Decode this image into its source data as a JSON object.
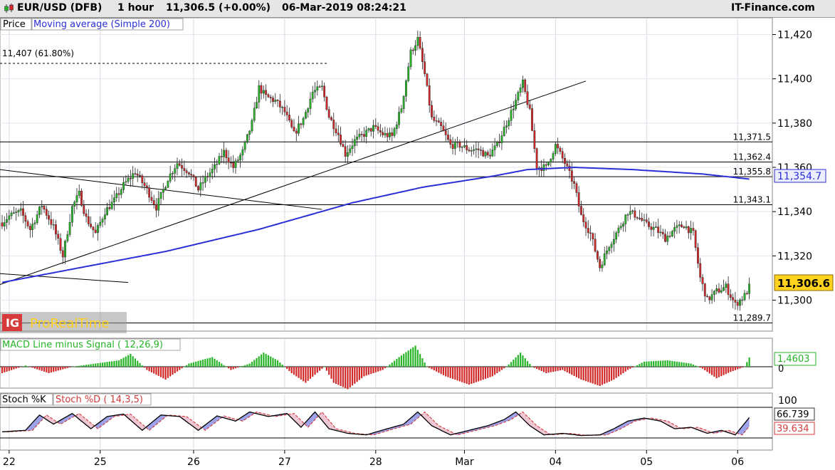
{
  "header": {
    "instrument": "EUR/USD (DFB)",
    "timeframe": "1 hour",
    "last_price": "11,306.5 (+0.00%)",
    "datetime": "06-Mar-2019 08:24:21",
    "brand": "IT-Finance.com"
  },
  "price_panel": {
    "legend_price": "Price",
    "legend_ma": "Moving average (Simple 200)",
    "fib_label": "11,407 (61.80%)",
    "watermark": "ProRealTime",
    "watermark_logo_letters": "IG",
    "current_price_tag": "11,306.6",
    "ma_value_tag": "11,354.7"
  },
  "macd_panel": {
    "legend": "MACD Line minus Signal ( 12,26,9)",
    "value_tag": "1,4603",
    "zero_label": "0"
  },
  "stoch_panel": {
    "legend_k": "Stoch %K",
    "legend_d": "Stoch %D ( 14,3,5)",
    "level_label": "100",
    "k_value_tag": "66.739",
    "d_value_tag": "39.634"
  },
  "colors": {
    "up": "#27b327",
    "down": "#d02828",
    "ma": "#2b2fd6",
    "price_tag": "#ffd21f",
    "stoch_k": "#000000",
    "stoch_d": "#d23b3b"
  },
  "chart_data": {
    "type": "candlestick",
    "y_axis_ticks": [
      11420,
      11400,
      11380,
      11360,
      11340,
      11320,
      11300
    ],
    "y_axis_tick_labels": [
      "11,420",
      "11,400",
      "11,380",
      "11,360",
      "11,340",
      "11,320",
      "11,300"
    ],
    "ylim": [
      11286,
      11425
    ],
    "x_axis_labels": [
      "22",
      "25",
      "26",
      "27",
      "28",
      "Mar",
      "04",
      "05",
      "06"
    ],
    "x_axis_label_index": [
      3,
      42,
      82,
      121,
      160,
      198,
      237,
      276,
      315
    ],
    "horizontal_levels": [
      {
        "value": 11371.5,
        "label": "11,371.5"
      },
      {
        "value": 11362.4,
        "label": "11,362.4"
      },
      {
        "value": 11355.8,
        "label": "11,355.8"
      },
      {
        "value": 11343.1,
        "label": "11,343.1"
      },
      {
        "value": 11289.7,
        "label": "11,289.7"
      }
    ],
    "fib_level": {
      "value": 11407,
      "label": "11,407 (61.80%)"
    },
    "trend_lines": [
      {
        "start": [
          -1,
          11307
        ],
        "end": [
          250,
          11399
        ]
      },
      {
        "start": [
          -1,
          11359
        ],
        "end": [
          137,
          11341
        ]
      },
      {
        "start": [
          -1,
          11312
        ],
        "end": [
          54,
          11308
        ]
      }
    ],
    "price_key_points": [
      [
        0,
        11335
      ],
      [
        3,
        11338
      ],
      [
        8,
        11340
      ],
      [
        12,
        11332
      ],
      [
        17,
        11343
      ],
      [
        22,
        11333
      ],
      [
        26,
        11320
      ],
      [
        30,
        11342
      ],
      [
        33,
        11348
      ],
      [
        36,
        11337
      ],
      [
        40,
        11330
      ],
      [
        44,
        11340
      ],
      [
        48,
        11345
      ],
      [
        52,
        11352
      ],
      [
        57,
        11358
      ],
      [
        62,
        11350
      ],
      [
        66,
        11342
      ],
      [
        71,
        11355
      ],
      [
        75,
        11362
      ],
      [
        80,
        11358
      ],
      [
        84,
        11350
      ],
      [
        87,
        11355
      ],
      [
        91,
        11360
      ],
      [
        95,
        11367
      ],
      [
        99,
        11360
      ],
      [
        103,
        11367
      ],
      [
        107,
        11380
      ],
      [
        110,
        11396
      ],
      [
        113,
        11392
      ],
      [
        117,
        11390
      ],
      [
        121,
        11385
      ],
      [
        125,
        11375
      ],
      [
        129,
        11382
      ],
      [
        133,
        11394
      ],
      [
        137,
        11396
      ],
      [
        140,
        11383
      ],
      [
        144,
        11375
      ],
      [
        147,
        11366
      ],
      [
        151,
        11372
      ],
      [
        155,
        11375
      ],
      [
        159,
        11378
      ],
      [
        163,
        11375
      ],
      [
        167,
        11374
      ],
      [
        171,
        11387
      ],
      [
        175,
        11412
      ],
      [
        178,
        11418
      ],
      [
        181,
        11402
      ],
      [
        184,
        11382
      ],
      [
        188,
        11378
      ],
      [
        192,
        11370
      ],
      [
        196,
        11370
      ],
      [
        200,
        11368
      ],
      [
        204,
        11368
      ],
      [
        208,
        11365
      ],
      [
        212,
        11370
      ],
      [
        216,
        11380
      ],
      [
        220,
        11390
      ],
      [
        223,
        11398
      ],
      [
        226,
        11385
      ],
      [
        229,
        11360
      ],
      [
        233,
        11360
      ],
      [
        237,
        11370
      ],
      [
        241,
        11362
      ],
      [
        245,
        11352
      ],
      [
        248,
        11338
      ],
      [
        252,
        11330
      ],
      [
        256,
        11315
      ],
      [
        260,
        11325
      ],
      [
        264,
        11332
      ],
      [
        268,
        11340
      ],
      [
        272,
        11338
      ],
      [
        276,
        11334
      ],
      [
        280,
        11332
      ],
      [
        284,
        11328
      ],
      [
        288,
        11332
      ],
      [
        292,
        11334
      ],
      [
        296,
        11330
      ],
      [
        299,
        11310
      ],
      [
        302,
        11300
      ],
      [
        306,
        11304
      ],
      [
        310,
        11306
      ],
      [
        314,
        11298
      ],
      [
        318,
        11302
      ],
      [
        320,
        11306
      ]
    ],
    "ma200_key_points": [
      [
        0,
        11308
      ],
      [
        30,
        11314
      ],
      [
        70,
        11322
      ],
      [
        110,
        11332
      ],
      [
        150,
        11344
      ],
      [
        180,
        11351
      ],
      [
        210,
        11356
      ],
      [
        225,
        11359
      ],
      [
        245,
        11360
      ],
      [
        270,
        11359
      ],
      [
        300,
        11357
      ],
      [
        320,
        11354.7
      ]
    ],
    "macd_key_points": [
      [
        0,
        -1.0
      ],
      [
        10,
        0.2
      ],
      [
        20,
        -1.0
      ],
      [
        30,
        0.0
      ],
      [
        40,
        0.5
      ],
      [
        50,
        1.0
      ],
      [
        55,
        2.0
      ],
      [
        62,
        -0.5
      ],
      [
        70,
        -2.0
      ],
      [
        80,
        0.5
      ],
      [
        90,
        1.5
      ],
      [
        98,
        -0.5
      ],
      [
        106,
        0.5
      ],
      [
        112,
        2.2
      ],
      [
        118,
        1.0
      ],
      [
        124,
        -1.0
      ],
      [
        130,
        -2.5
      ],
      [
        138,
        0.0
      ],
      [
        142,
        -2.5
      ],
      [
        148,
        -3.5
      ],
      [
        155,
        -1.5
      ],
      [
        163,
        -0.5
      ],
      [
        170,
        1.5
      ],
      [
        177,
        3.3
      ],
      [
        182,
        0.0
      ],
      [
        190,
        -1.5
      ],
      [
        200,
        -2.8
      ],
      [
        210,
        -1.5
      ],
      [
        216,
        0.0
      ],
      [
        222,
        2.2
      ],
      [
        227,
        0.0
      ],
      [
        233,
        -1.0
      ],
      [
        240,
        -0.5
      ],
      [
        248,
        -2.0
      ],
      [
        256,
        -3.0
      ],
      [
        262,
        -2.0
      ],
      [
        268,
        -0.5
      ],
      [
        275,
        0.8
      ],
      [
        285,
        1.0
      ],
      [
        295,
        0.5
      ],
      [
        300,
        -0.3
      ],
      [
        306,
        -1.8
      ],
      [
        312,
        -0.8
      ],
      [
        318,
        0.0
      ],
      [
        320,
        1.46
      ]
    ],
    "stoch_k_key_points": [
      [
        0,
        20
      ],
      [
        10,
        25
      ],
      [
        16,
        75
      ],
      [
        22,
        45
      ],
      [
        30,
        80
      ],
      [
        38,
        30
      ],
      [
        45,
        70
      ],
      [
        52,
        78
      ],
      [
        60,
        25
      ],
      [
        68,
        75
      ],
      [
        76,
        70
      ],
      [
        84,
        25
      ],
      [
        92,
        72
      ],
      [
        100,
        55
      ],
      [
        106,
        85
      ],
      [
        114,
        70
      ],
      [
        122,
        80
      ],
      [
        128,
        35
      ],
      [
        134,
        85
      ],
      [
        140,
        30
      ],
      [
        148,
        15
      ],
      [
        156,
        10
      ],
      [
        164,
        28
      ],
      [
        172,
        45
      ],
      [
        178,
        85
      ],
      [
        184,
        40
      ],
      [
        192,
        10
      ],
      [
        200,
        25
      ],
      [
        208,
        40
      ],
      [
        215,
        60
      ],
      [
        220,
        85
      ],
      [
        226,
        40
      ],
      [
        232,
        10
      ],
      [
        240,
        15
      ],
      [
        248,
        8
      ],
      [
        256,
        10
      ],
      [
        262,
        30
      ],
      [
        268,
        55
      ],
      [
        275,
        65
      ],
      [
        282,
        55
      ],
      [
        288,
        30
      ],
      [
        295,
        35
      ],
      [
        302,
        15
      ],
      [
        308,
        25
      ],
      [
        314,
        10
      ],
      [
        320,
        66.7
      ]
    ],
    "stoch_d_lag": 3
  }
}
